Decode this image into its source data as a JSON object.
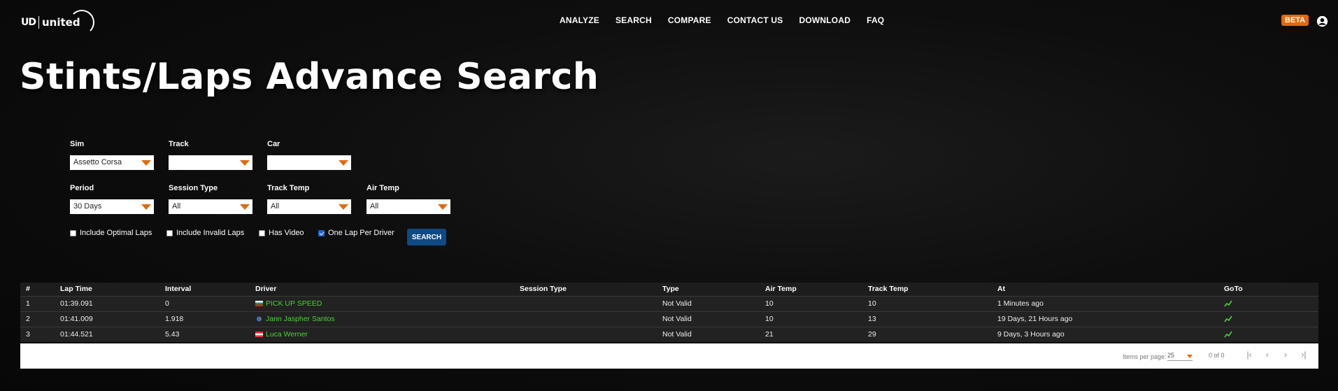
{
  "header": {
    "logo_mark": "UD",
    "logo_word": "united",
    "nav": [
      "ANALYZE",
      "SEARCH",
      "COMPARE",
      "CONTACT US",
      "DOWNLOAD",
      "FAQ"
    ],
    "beta_badge": "BETA"
  },
  "page": {
    "title": "Stints/Laps Advance Search"
  },
  "filters": {
    "sim": {
      "label": "Sim",
      "value": "Assetto Corsa"
    },
    "track": {
      "label": "Track",
      "value": ""
    },
    "car": {
      "label": "Car",
      "value": ""
    },
    "period": {
      "label": "Period",
      "value": "30 Days"
    },
    "session_type": {
      "label": "Session Type",
      "value": "All"
    },
    "track_temp": {
      "label": "Track Temp",
      "value": "All"
    },
    "air_temp": {
      "label": "Air Temp",
      "value": "All"
    }
  },
  "options": [
    {
      "label": "Include Optimal Laps",
      "checked": false
    },
    {
      "label": "Include Invalid Laps",
      "checked": false
    },
    {
      "label": "Has Video",
      "checked": false
    },
    {
      "label": "One Lap Per Driver",
      "checked": true
    }
  ],
  "search_button": "SEARCH",
  "table": {
    "columns": [
      "#",
      "Lap Time",
      "Interval",
      "Driver",
      "Session Type",
      "Type",
      "Air Temp",
      "Track Temp",
      "At",
      "GoTo"
    ],
    "rows": [
      {
        "num": "1",
        "lap_time": "01:39.091",
        "interval": "0",
        "driver": "PICK UP SPEED",
        "flag": "bulgaria",
        "session_type": "",
        "type": "Not Valid",
        "air_temp": "10",
        "track_temp": "10",
        "at": "1 Minutes ago"
      },
      {
        "num": "2",
        "lap_time": "01:41.009",
        "interval": "1.918",
        "driver": "Jann Jaspher Santos",
        "flag": "eu",
        "session_type": "",
        "type": "Not Valid",
        "air_temp": "10",
        "track_temp": "13",
        "at": "19 Days, 21 Hours ago"
      },
      {
        "num": "3",
        "lap_time": "01:44.521",
        "interval": "5.43",
        "driver": "Luca Werner",
        "flag": "austria",
        "session_type": "",
        "type": "Not Valid",
        "air_temp": "21",
        "track_temp": "29",
        "at": "9 Days, 3 Hours ago"
      }
    ]
  },
  "paginator": {
    "items_per_page_label": "Items per page:",
    "items_per_page": "25",
    "range": "0 of 0"
  },
  "colors": {
    "accent": "#e06a10",
    "link_green": "#4cd137",
    "button_blue": "#0f4a82"
  }
}
